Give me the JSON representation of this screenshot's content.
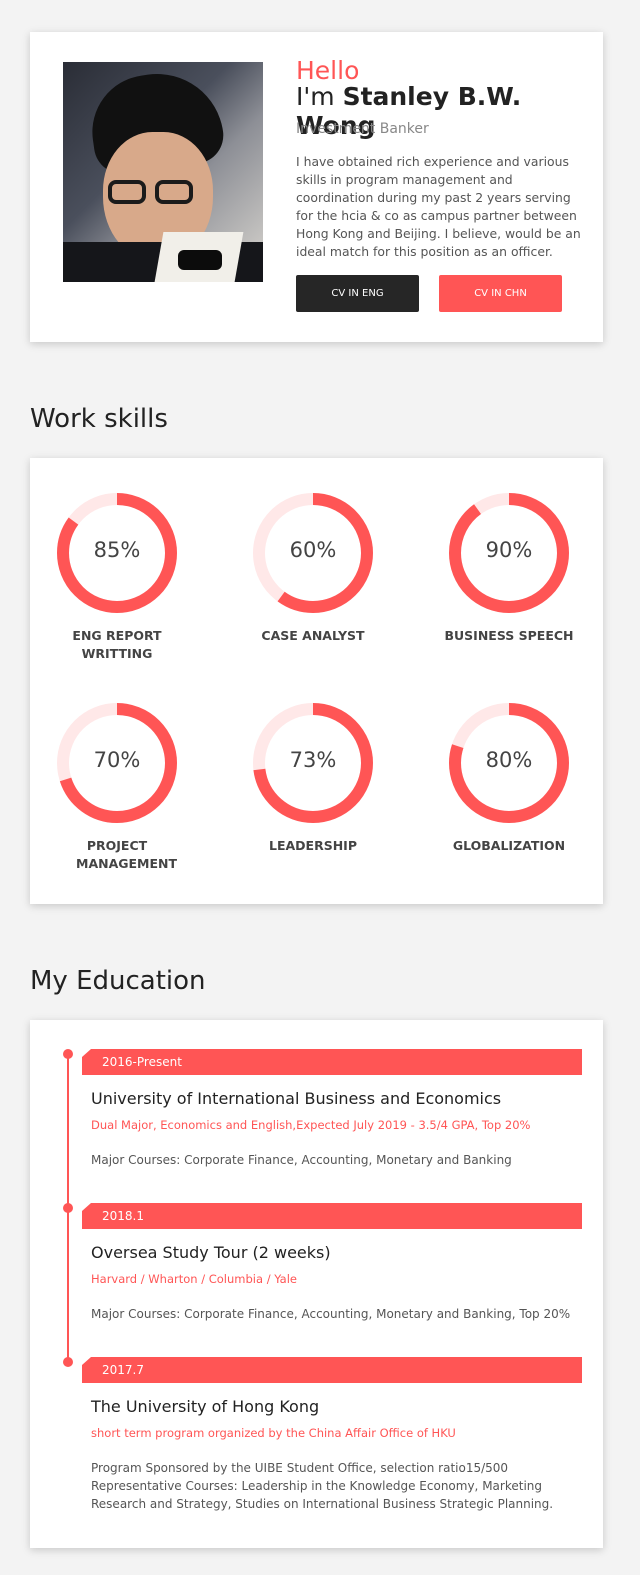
{
  "profile": {
    "greeting": "Hello",
    "name_prefix": "I'm",
    "name": "Stanley B.W. Wong",
    "title": "Investment Banker",
    "bio": "I have obtained rich experience and various skills in program management and coordination during my past 2 years serving for the hcia & co as campus partner between Hong Kong and Beijing. I believe, would be an ideal match for this position as an officer.",
    "buttons": {
      "cv_eng": "CV IN ENG",
      "cv_chn": "CV IN CHN"
    }
  },
  "skills_section": {
    "title": "Work skills",
    "items": [
      {
        "percent": 85,
        "percent_label": "85%",
        "label": "ENG REPORT WRITTING"
      },
      {
        "percent": 60,
        "percent_label": "60%",
        "label": "CASE ANALYST"
      },
      {
        "percent": 90,
        "percent_label": "90%",
        "label": "BUSINESS SPEECH"
      },
      {
        "percent": 70,
        "percent_label": "70%",
        "label": "PROJECT MANAGEMENT"
      },
      {
        "percent": 73,
        "percent_label": "73%",
        "label": "LEADERSHIP"
      },
      {
        "percent": 80,
        "percent_label": "80%",
        "label": "GLOBALIZATION"
      }
    ]
  },
  "education_section": {
    "title": "My Education",
    "items": [
      {
        "period": "2016-Present",
        "school": "University of International Business and Economics",
        "detail": "Dual Major, Economics and English,Expected July 2019 - 3.5/4 GPA, Top 20%",
        "courses": "Major Courses: Corporate Finance, Accounting, Monetary and Banking"
      },
      {
        "period": "2018.1",
        "school": "Oversea Study Tour (2 weeks)",
        "detail": "Harvard / Wharton / Columbia / Yale",
        "courses": "Major Courses: Corporate Finance, Accounting, Monetary and Banking, Top 20%"
      },
      {
        "period": "2017.7",
        "school": "The University of Hong Kong",
        "detail": "short term program organized by the China Affair Office of HKU",
        "courses": "Program Sponsored by the UIBE Student Office, selection ratio15/500 Representative Courses: Leadership in the Knowledge Economy, Marketing Research and Strategy, Studies on International Business Strategic Planning."
      }
    ]
  },
  "colors": {
    "accent": "#ff5555",
    "accent_light": "#ffe8e8",
    "dark_button": "#262626"
  }
}
